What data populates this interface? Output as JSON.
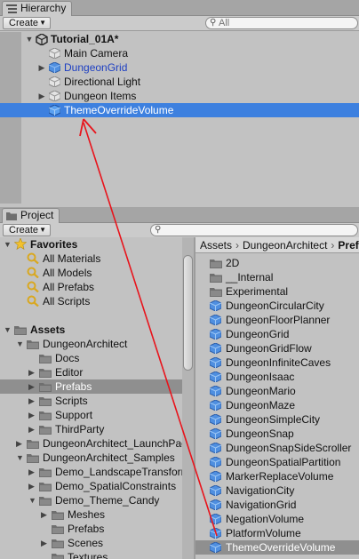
{
  "hierarchy": {
    "tab_label": "Hierarchy",
    "create_label": "Create",
    "search_placeholder": "All",
    "scene_name": "Tutorial_01A*",
    "items": [
      {
        "label": "Main Camera",
        "icon": "gameobject-icon"
      },
      {
        "label": "DungeonGrid",
        "icon": "prefab-icon",
        "expandable": true,
        "color": "#1d3fc2"
      },
      {
        "label": "Directional Light",
        "icon": "gameobject-icon"
      },
      {
        "label": "Dungeon Items",
        "icon": "gameobject-icon",
        "expandable": true
      },
      {
        "label": "ThemeOverrideVolume",
        "icon": "prefab-icon",
        "selected": true
      }
    ]
  },
  "project": {
    "tab_label": "Project",
    "create_label": "Create",
    "favorites": {
      "label": "Favorites",
      "items": [
        "All Materials",
        "All Models",
        "All Prefabs",
        "All Scripts"
      ]
    },
    "assets": {
      "label": "Assets",
      "tree": [
        {
          "label": "DungeonArchitect",
          "depth": 1,
          "expanded": true
        },
        {
          "label": "Docs",
          "depth": 2
        },
        {
          "label": "Editor",
          "depth": 2,
          "expandable": true
        },
        {
          "label": "Prefabs",
          "depth": 2,
          "expandable": true,
          "selected": true
        },
        {
          "label": "Scripts",
          "depth": 2,
          "expandable": true
        },
        {
          "label": "Support",
          "depth": 2,
          "expandable": true
        },
        {
          "label": "ThirdParty",
          "depth": 2,
          "expandable": true
        },
        {
          "label": "DungeonArchitect_LaunchPad",
          "depth": 1,
          "expandable": true
        },
        {
          "label": "DungeonArchitect_Samples",
          "depth": 1,
          "expanded": true
        },
        {
          "label": "Demo_LandscapeTransform",
          "depth": 2,
          "expandable": true
        },
        {
          "label": "Demo_SpatialConstraints",
          "depth": 2,
          "expandable": true
        },
        {
          "label": "Demo_Theme_Candy",
          "depth": 2,
          "expanded": true
        },
        {
          "label": "Meshes",
          "depth": 3,
          "expandable": true
        },
        {
          "label": "Prefabs",
          "depth": 3
        },
        {
          "label": "Scenes",
          "depth": 3,
          "expandable": true
        },
        {
          "label": "Textures",
          "depth": 3
        }
      ]
    },
    "breadcrumb": [
      "Assets",
      "DungeonArchitect",
      "Prefabs"
    ],
    "contents": [
      {
        "label": "2D",
        "type": "folder"
      },
      {
        "label": "__Internal",
        "type": "folder"
      },
      {
        "label": "Experimental",
        "type": "folder"
      },
      {
        "label": "DungeonCircularCity",
        "type": "prefab"
      },
      {
        "label": "DungeonFloorPlanner",
        "type": "prefab"
      },
      {
        "label": "DungeonGrid",
        "type": "prefab"
      },
      {
        "label": "DungeonGridFlow",
        "type": "prefab"
      },
      {
        "label": "DungeonInfiniteCaves",
        "type": "prefab"
      },
      {
        "label": "DungeonIsaac",
        "type": "prefab"
      },
      {
        "label": "DungeonMario",
        "type": "prefab"
      },
      {
        "label": "DungeonMaze",
        "type": "prefab"
      },
      {
        "label": "DungeonSimpleCity",
        "type": "prefab"
      },
      {
        "label": "DungeonSnap",
        "type": "prefab"
      },
      {
        "label": "DungeonSnapSideScroller",
        "type": "prefab"
      },
      {
        "label": "DungeonSpatialPartition",
        "type": "prefab"
      },
      {
        "label": "MarkerReplaceVolume",
        "type": "prefab"
      },
      {
        "label": "NavigationCity",
        "type": "prefab"
      },
      {
        "label": "NavigationGrid",
        "type": "prefab"
      },
      {
        "label": "NegationVolume",
        "type": "prefab"
      },
      {
        "label": "PlatformVolume",
        "type": "prefab"
      },
      {
        "label": "ThemeOverrideVolume",
        "type": "prefab",
        "selected": true
      }
    ]
  },
  "colors": {
    "selection_blue": "#3d80df",
    "drag_arrow": "#e8141c"
  }
}
